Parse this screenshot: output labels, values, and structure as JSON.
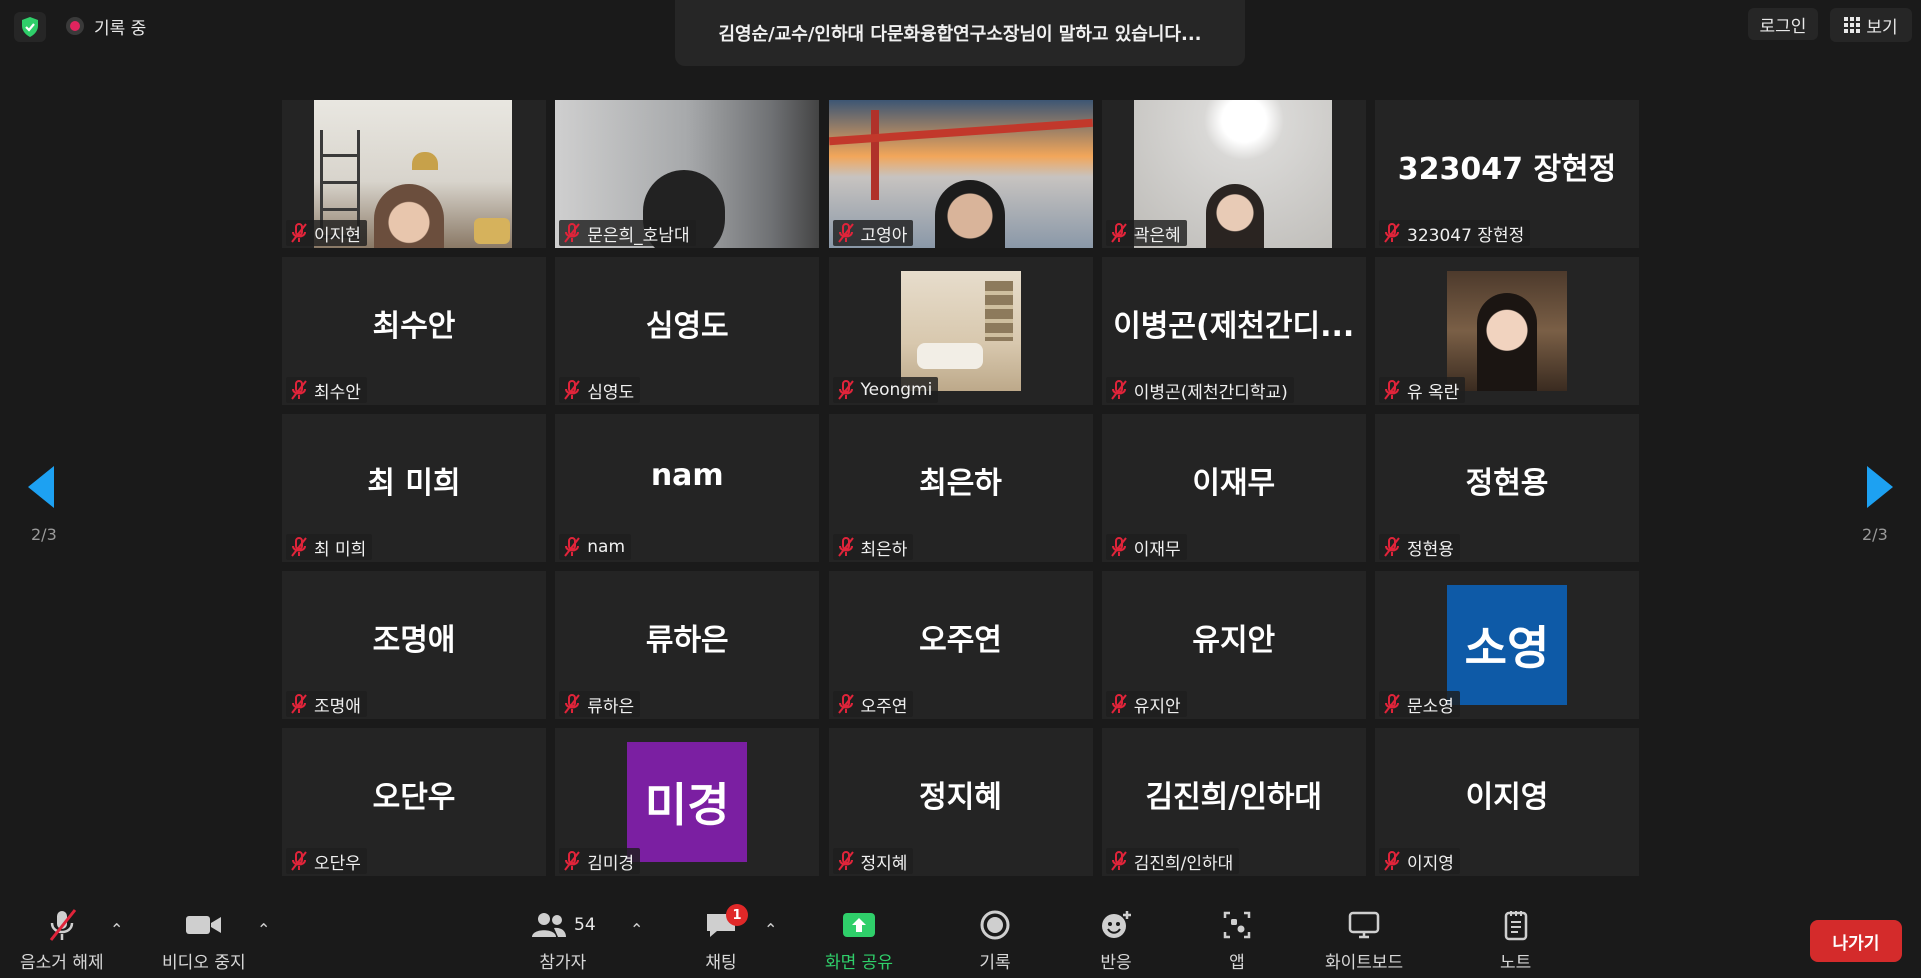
{
  "topbar": {
    "recording_label": "기록 중",
    "speaker_text": "김영순/교수/인하대 다문화융합연구소장님이 말하고 있습니다...",
    "login_label": "로그인",
    "view_label": "보기"
  },
  "pager": {
    "left": "2/3",
    "right": "2/3"
  },
  "tiles": [
    {
      "big": "",
      "label": "이지현"
    },
    {
      "big": "",
      "label": "문은희_호남대"
    },
    {
      "big": "",
      "label": "고영아"
    },
    {
      "big": "",
      "label": "곽은혜"
    },
    {
      "big": "323047 장현정",
      "label": "323047 장현정"
    },
    {
      "big": "최수안",
      "label": "최수안"
    },
    {
      "big": "심영도",
      "label": "심영도"
    },
    {
      "big": "",
      "label": "Yeongmi"
    },
    {
      "big": "이병곤(제천간디...",
      "label": "이병곤(제천간디학교)"
    },
    {
      "big": "",
      "label": "유 옥란"
    },
    {
      "big": "최 미희",
      "label": "최 미희"
    },
    {
      "big": "nam",
      "label": "nam"
    },
    {
      "big": "최은하",
      "label": "최은하"
    },
    {
      "big": "이재무",
      "label": "이재무"
    },
    {
      "big": "정현용",
      "label": "정현용"
    },
    {
      "big": "조명애",
      "label": "조명애"
    },
    {
      "big": "류하은",
      "label": "류하은"
    },
    {
      "big": "오주연",
      "label": "오주연"
    },
    {
      "big": "유지안",
      "label": "유지안"
    },
    {
      "big": "",
      "avatar": "소영",
      "avatar_color": "#0e5aa7",
      "label": "문소영"
    },
    {
      "big": "오단우",
      "label": "오단우"
    },
    {
      "big": "",
      "avatar": "미경",
      "avatar_color": "#7b1fa2",
      "label": "김미경"
    },
    {
      "big": "정지혜",
      "label": "정지혜"
    },
    {
      "big": "김진희/인하대",
      "label": "김진희/인하대"
    },
    {
      "big": "이지영",
      "label": "이지영"
    }
  ],
  "toolbar": {
    "unmute_label": "음소거 해제",
    "video_label": "비디오 중지",
    "participants_label": "참가자",
    "participants_count": "54",
    "chat_label": "채팅",
    "chat_badge": "1",
    "share_label": "화면 공유",
    "record_label": "기록",
    "reactions_label": "반응",
    "apps_label": "앱",
    "whiteboard_label": "화이트보드",
    "notes_label": "노트",
    "leave_label": "나가기"
  },
  "colors": {
    "accent": "#1da1f2",
    "share_green": "#2fcf6a",
    "leave_red": "#d42b2b",
    "muted_red": "#e0243a"
  }
}
